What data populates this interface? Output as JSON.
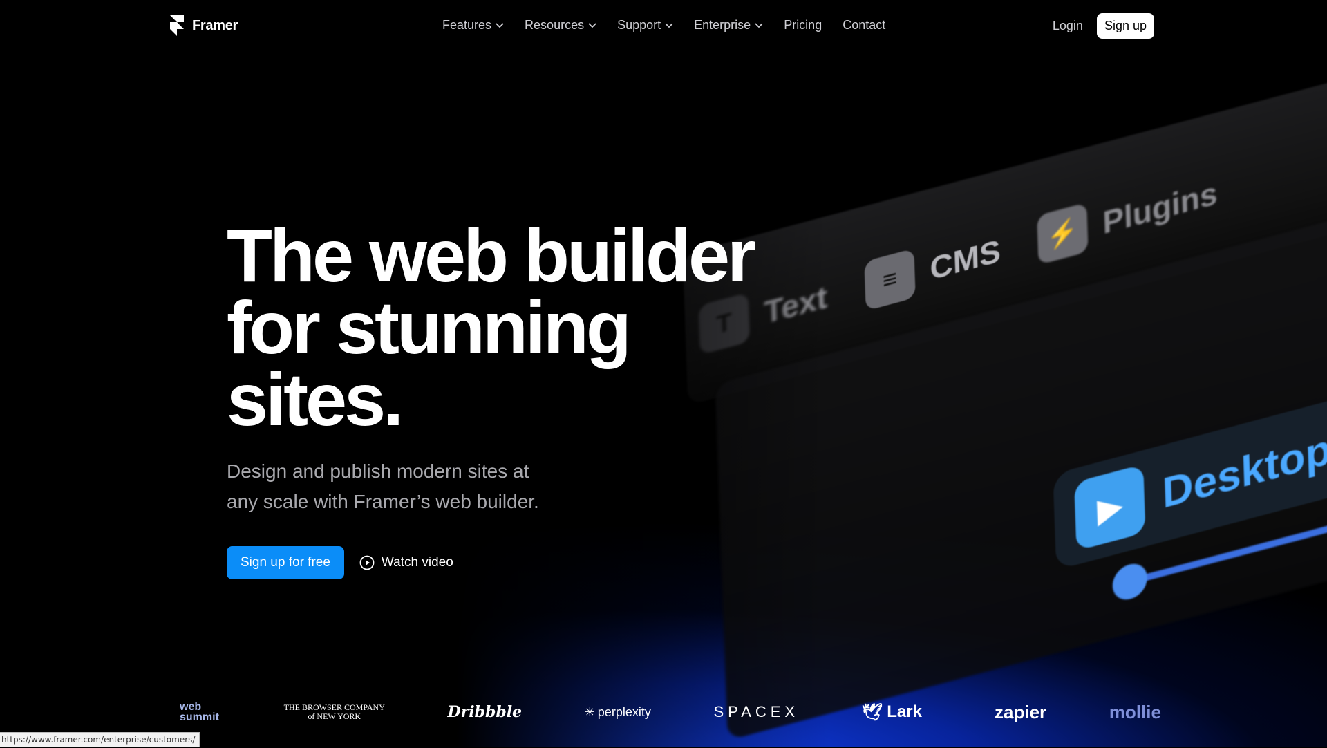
{
  "nav": {
    "brand": "Framer",
    "menu": [
      {
        "label": "Features",
        "has_dropdown": true
      },
      {
        "label": "Resources",
        "has_dropdown": true
      },
      {
        "label": "Support",
        "has_dropdown": true
      },
      {
        "label": "Enterprise",
        "has_dropdown": true
      },
      {
        "label": "Pricing",
        "has_dropdown": false
      },
      {
        "label": "Contact",
        "has_dropdown": false
      }
    ],
    "login": "Login",
    "signup": "Sign up"
  },
  "hero": {
    "title_line1": "The web builder",
    "title_line2": "for stunning sites.",
    "subtitle": "Design and publish modern sites at any scale with Framer’s web builder.",
    "cta_primary": "Sign up for free",
    "cta_secondary": "Watch video"
  },
  "mock_ui": {
    "items": [
      "Text",
      "CMS",
      "Plugins"
    ],
    "desktop": "Desktop"
  },
  "logos": {
    "websummit": [
      "web",
      "summit"
    ],
    "browser_company": [
      "THE BROWSER COMPANY",
      "of NEW YORK"
    ],
    "dribbble": "Dribbble",
    "perplexity": "perplexity",
    "spacex": "SPACEX",
    "lark": "Lark",
    "zapier": "_zapier",
    "mollie": "mollie"
  },
  "status_bar": "https://www.framer.com/enterprise/customers/",
  "colors": {
    "background": "#000000",
    "accent_blue": "#0b8df8",
    "glow_blue": "#1446ff"
  }
}
